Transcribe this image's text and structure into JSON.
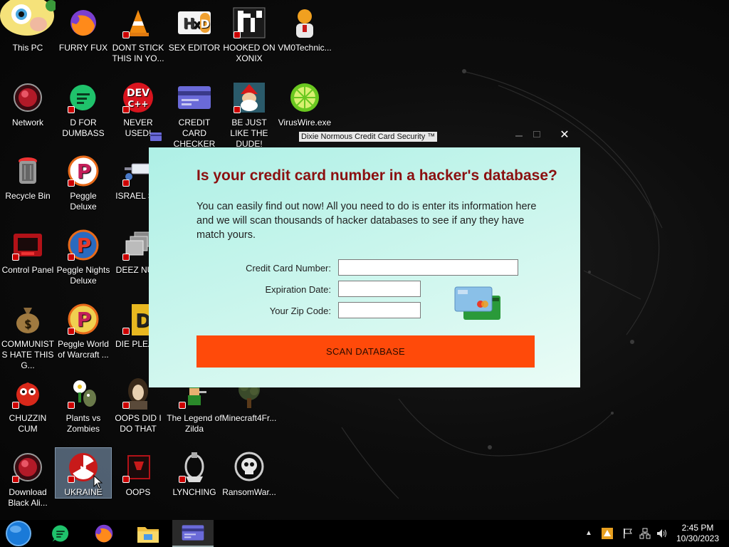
{
  "desktop": {
    "icons": [
      {
        "label": "This PC",
        "icon": "this-pc-icon"
      },
      {
        "label": "FURRY FUX",
        "icon": "firefox-icon"
      },
      {
        "label": "DONT STICK THIS IN YO...",
        "icon": "vlc-cone-icon"
      },
      {
        "label": "SEX EDITOR",
        "icon": "hxd-icon"
      },
      {
        "label": "HOOKED ON XONIX",
        "icon": "xonix-icon"
      },
      {
        "label": "VM0Technic...",
        "icon": "technician-icon"
      },
      {
        "label": "Network",
        "icon": "network-orb-icon"
      },
      {
        "label": "D FOR DUMBASS",
        "icon": "green-chat-icon"
      },
      {
        "label": "NEVER USED!",
        "icon": "devcpp-icon"
      },
      {
        "label": "CREDIT CARD CHECKER",
        "icon": "credit-card-icon"
      },
      {
        "label": "BE JUST LIKE THE DUDE!",
        "icon": "santa-icon"
      },
      {
        "label": "VirusWire.exe",
        "icon": "lime-icon"
      },
      {
        "label": "Recycle Bin",
        "icon": "recycle-bin-icon"
      },
      {
        "label": "Peggle Deluxe",
        "icon": "peggle-icon"
      },
      {
        "label": "ISRAEL S...",
        "icon": "syringe-icon"
      },
      {
        "label": "Control Panel",
        "icon": "control-panel-icon"
      },
      {
        "label": "Peggle Nights Deluxe",
        "icon": "peggle-nights-icon"
      },
      {
        "label": "DEEZ NU...",
        "icon": "stacked-windows-icon"
      },
      {
        "label": "COMMUNISTS HATE THIS G...",
        "icon": "money-bag-icon"
      },
      {
        "label": "Peggle World of Warcraft ...",
        "icon": "peggle-wow-icon"
      },
      {
        "label": "DIE PLEA...",
        "icon": "die-icon"
      },
      {
        "label": "CHUZZIN CUM",
        "icon": "chuzzle-icon"
      },
      {
        "label": "Plants vs Zombies",
        "icon": "pvz-icon"
      },
      {
        "label": "OOPS DID I DO THAT",
        "icon": "portrait-icon"
      },
      {
        "label": "The Legend of Zilda",
        "icon": "zelda-icon"
      },
      {
        "label": "Minecraft4Fr...",
        "icon": "minecraft-tree-icon"
      },
      {
        "label": "Download Black Ali...",
        "icon": "alien-orb-icon"
      },
      {
        "label": "UKRAINE",
        "icon": "radiation-icon"
      },
      {
        "label": "OOPS",
        "icon": "red-app-icon"
      },
      {
        "label": "LYNCHING",
        "icon": "noose-icon"
      },
      {
        "label": "RansomWar...",
        "icon": "skull-icon"
      }
    ]
  },
  "popup": {
    "title": "Dixie Normous Credit Card Security ™",
    "close_glyph": "✕",
    "heading": "Is your credit card number in a hacker's database?",
    "description": "You can easily find out now! All you need to do is enter its information here and we will scan thousands of hacker databases to see if any they have match yours.",
    "fields": {
      "card_number_label": "Credit Card Number:",
      "card_number_value": "",
      "expiration_label": "Expiration Date:",
      "expiration_value": "",
      "zip_label": "Your Zip Code:",
      "zip_value": ""
    },
    "scan_button": "SCAN DATABASE",
    "colors": {
      "heading": "#8b1010",
      "button": "#ff4a0a",
      "background": "#c8f5ec"
    }
  },
  "taskbar": {
    "apps": [
      "start-orb-icon",
      "green-chat-icon",
      "firefox-icon",
      "file-explorer-icon",
      "credit-card-icon"
    ],
    "tray": [
      "chevron-up-icon",
      "app-tray-icon",
      "flag-icon",
      "network-icon",
      "volume-icon"
    ],
    "time": "2:45 PM",
    "date": "10/30/2023"
  }
}
